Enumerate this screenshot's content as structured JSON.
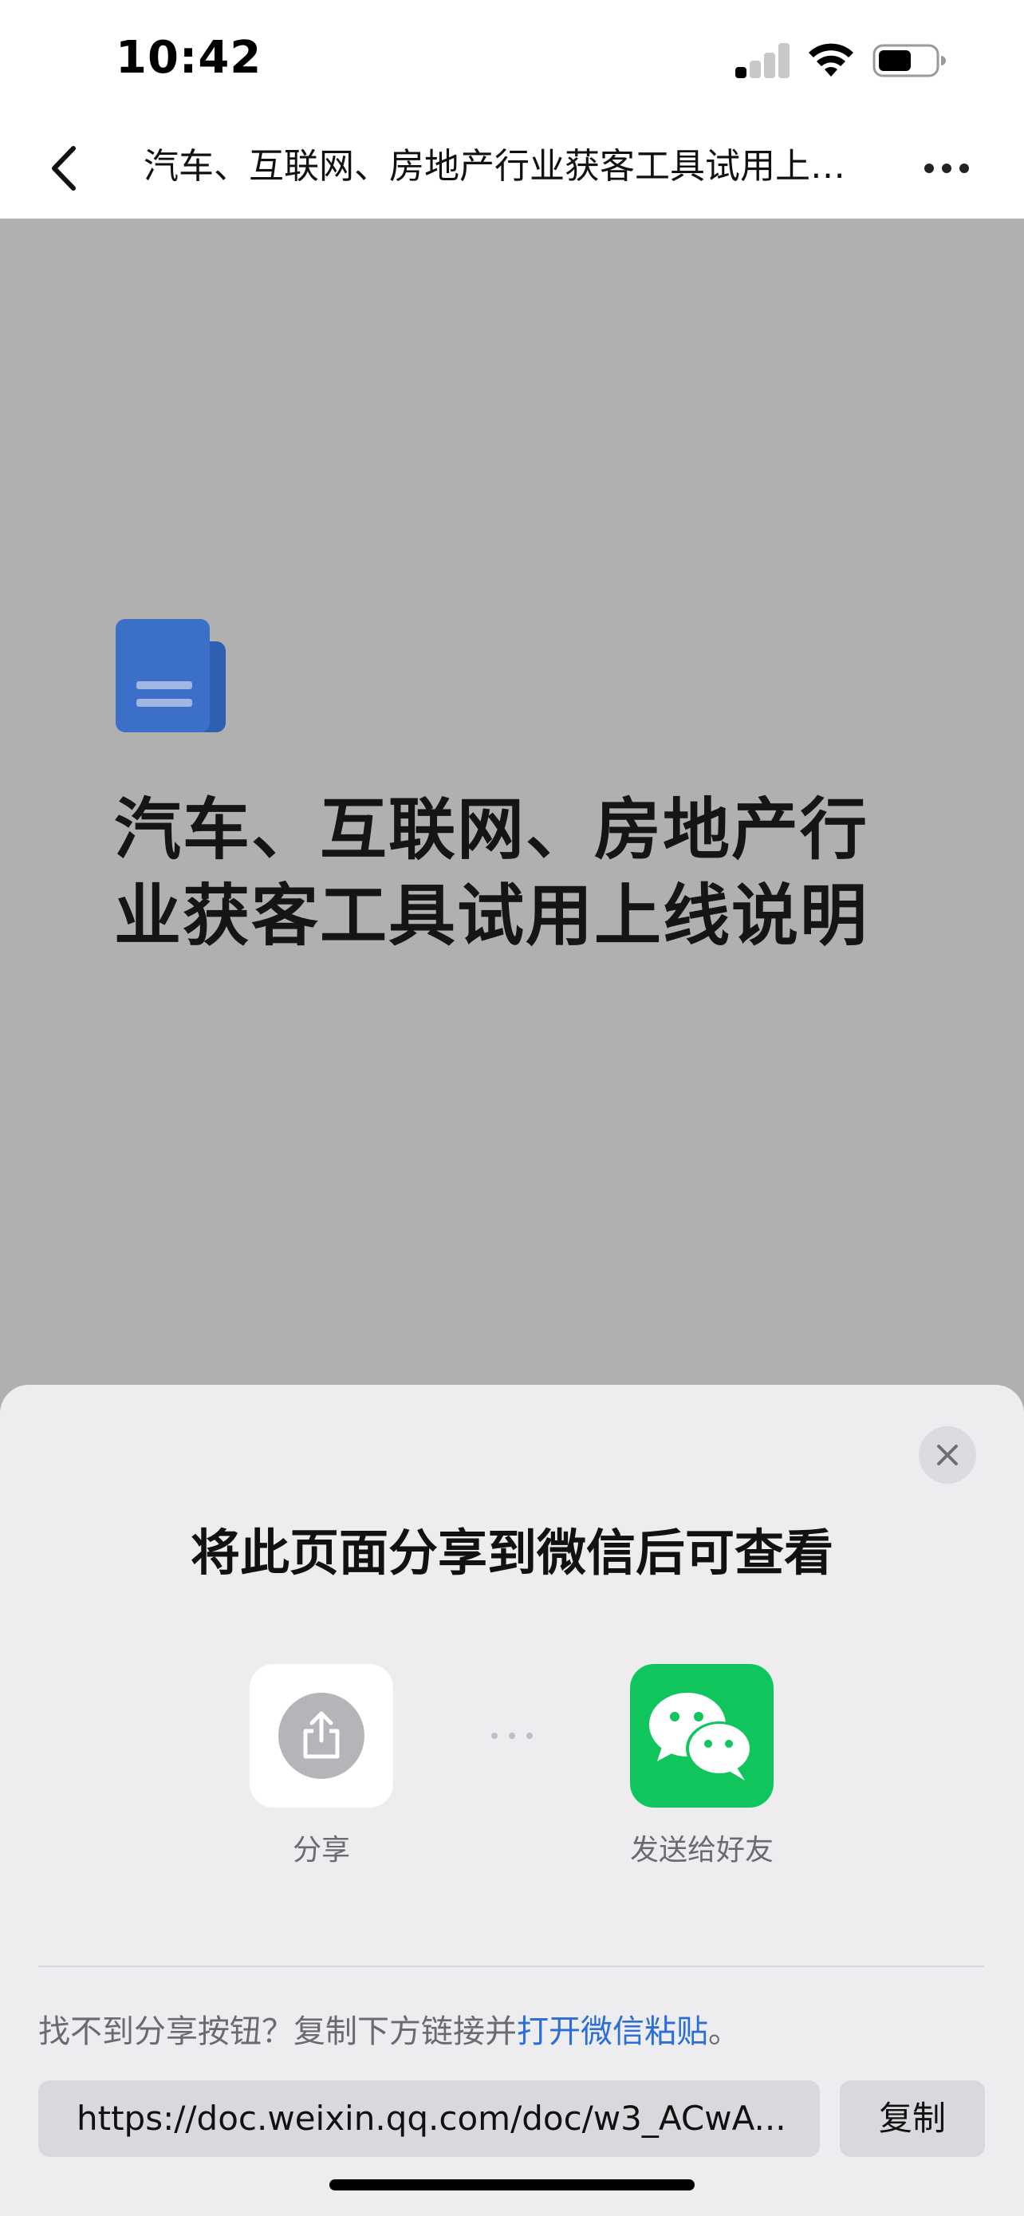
{
  "status_bar": {
    "time": "10:42",
    "signal_icon": "cellular-signal-icon",
    "wifi_icon": "wifi-icon",
    "battery_icon": "battery-icon"
  },
  "nav": {
    "back_icon": "chevron-left-icon",
    "title": "汽车、互联网、房地产行业获客工具试用上线说明",
    "more_icon": "more-dots-icon"
  },
  "document": {
    "icon": "document-icon",
    "title": "汽车、互联网、房地产行业获客工具试用上线说明"
  },
  "sheet": {
    "title": "将此页面分享到微信后可查看",
    "close_icon": "close-icon",
    "share_label": "分享",
    "share_icon": "share-upload-icon",
    "wechat_label": "发送给好友",
    "wechat_icon": "wechat-icon",
    "hint_prefix": "找不到分享按钮？复制下方链接并",
    "hint_link": "打开微信粘贴",
    "hint_suffix": "。",
    "url": "https://doc.weixin.qq.com/doc/w3_ACwA...",
    "copy_label": "复制"
  },
  "colors": {
    "overlay_gray": "#b0b0b0",
    "sheet_bg": "#ededf0",
    "link_blue": "#2b6ed8",
    "wechat_green": "#10c65c",
    "doc_blue": "#3b6fc8"
  }
}
